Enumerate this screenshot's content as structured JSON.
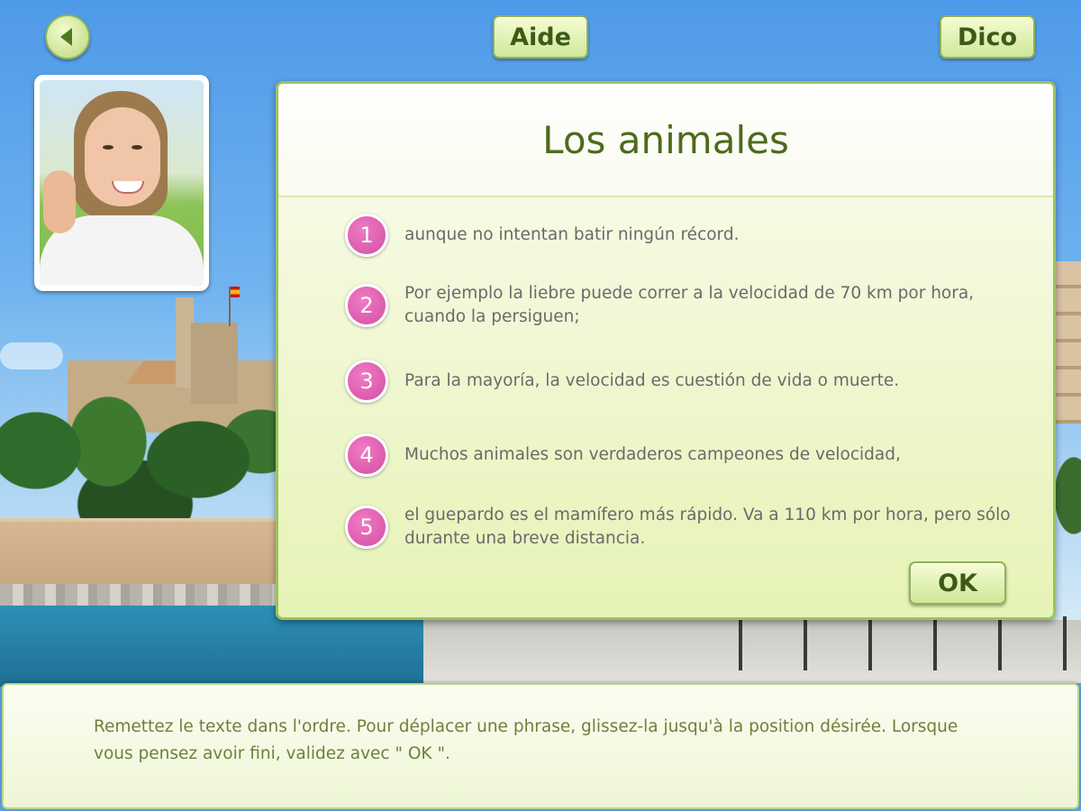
{
  "nav": {
    "back_icon": "arrow-left-icon",
    "aide_label": "Aide",
    "dico_label": "Dico"
  },
  "panel": {
    "title": "Los animales",
    "items": [
      {
        "number": "1",
        "text": "aunque no intentan batir ningún récord."
      },
      {
        "number": "2",
        "text": "Por ejemplo la liebre puede correr a la velocidad de 70 km por hora, cuando la persiguen;"
      },
      {
        "number": "3",
        "text": "Para la mayoría, la velocidad es cuestión de vida o muerte."
      },
      {
        "number": "4",
        "text": "Muchos animales son verdaderos campeones de velocidad,"
      },
      {
        "number": "5",
        "text": "el guepardo es el mamífero más rápido. Va a 110 km por hora, pero sólo durante una breve distancia."
      }
    ],
    "ok_label": "OK"
  },
  "instructions": {
    "text": "Remettez le texte dans l'ordre. Pour déplacer une phrase, glissez-la jusqu'à la position désirée. Lorsque vous pensez avoir fini, validez avec \" OK \"."
  },
  "colors": {
    "accent_green": "#8fb35b",
    "number_pink": "#d34ea3",
    "title_green": "#4d6b1c"
  }
}
